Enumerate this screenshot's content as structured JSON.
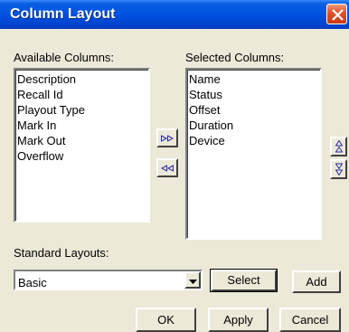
{
  "window": {
    "title": "Column Layout"
  },
  "available": {
    "label": "Available Columns:",
    "items": [
      "Description",
      "Recall Id",
      "Playout Type",
      "Mark In",
      "Mark Out",
      "Overflow"
    ]
  },
  "selected": {
    "label": "Selected Columns:",
    "items": [
      "Name",
      "Status",
      "Offset",
      "Duration",
      "Device"
    ]
  },
  "standard_layouts": {
    "label": "Standard Layouts:",
    "value": "Basic"
  },
  "buttons": {
    "select": "Select",
    "add": "Add",
    "ok": "OK",
    "apply": "Apply",
    "cancel": "Cancel"
  },
  "icons": {
    "close": "close-icon",
    "move_right": "double-arrow-right-icon",
    "move_left": "double-arrow-left-icon",
    "move_up": "arrow-up-icon",
    "move_down": "arrow-down-icon",
    "dropdown": "chevron-down-icon"
  },
  "colors": {
    "titlebar": "#0054e3",
    "dialog": "#ece9d8",
    "close": "#e0552d"
  }
}
